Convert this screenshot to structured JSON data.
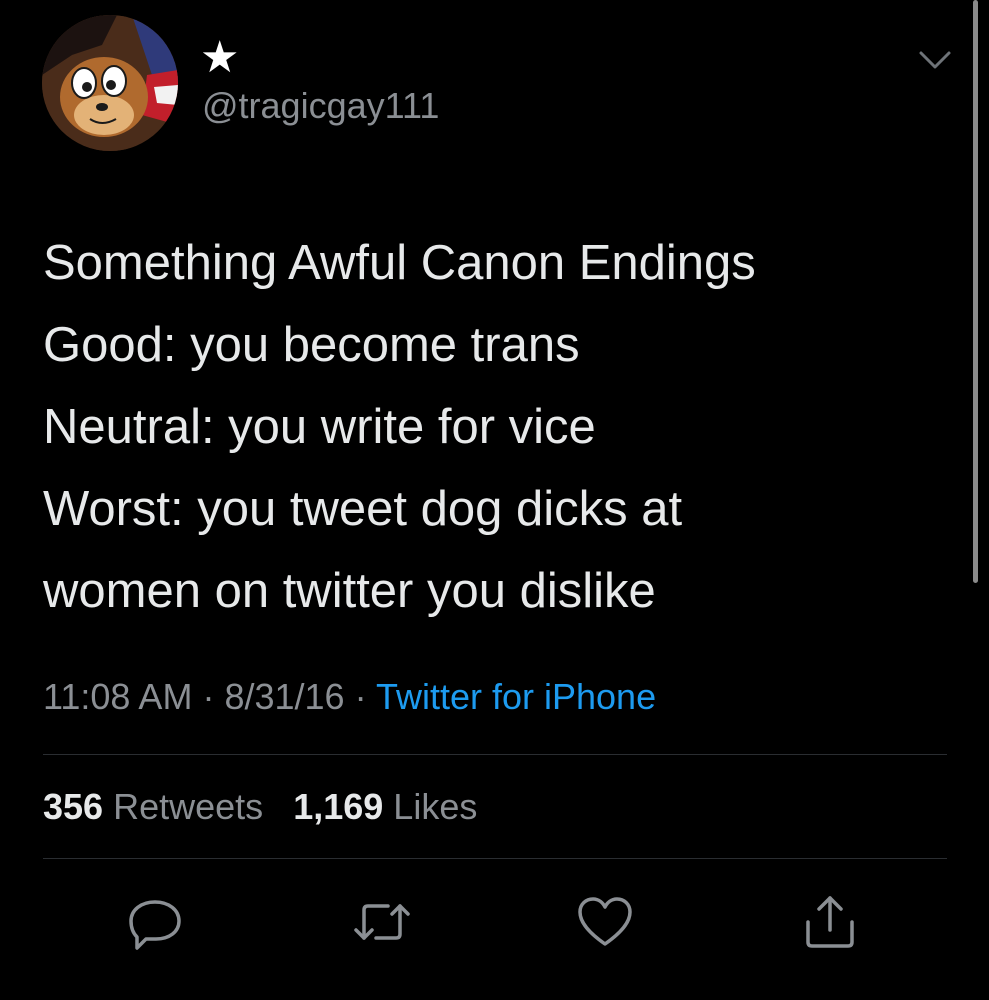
{
  "author": {
    "display_name": "★",
    "handle": "@tragicgay111",
    "avatar_icon": "cartoon-character-avatar"
  },
  "tweet": {
    "lines": [
      "Something Awful Canon Endings",
      "Good: you become trans",
      "Neutral: you write for vice",
      "Worst: you tweet dog dicks at",
      "women on twitter you dislike"
    ]
  },
  "meta": {
    "time": "11:08 AM",
    "date": "8/31/16",
    "separator": "·",
    "source": "Twitter for iPhone"
  },
  "stats": {
    "retweets_count": "356",
    "retweets_label": "Retweets",
    "likes_count": "1,169",
    "likes_label": "Likes"
  },
  "actions": [
    {
      "name": "reply",
      "icon": "reply-icon"
    },
    {
      "name": "retweet",
      "icon": "retweet-icon"
    },
    {
      "name": "like",
      "icon": "heart-icon"
    },
    {
      "name": "share",
      "icon": "share-icon"
    }
  ],
  "colors": {
    "background": "#000000",
    "text": "#e7e9ea",
    "secondary": "#8b8f94",
    "link": "#1d9bf0"
  }
}
